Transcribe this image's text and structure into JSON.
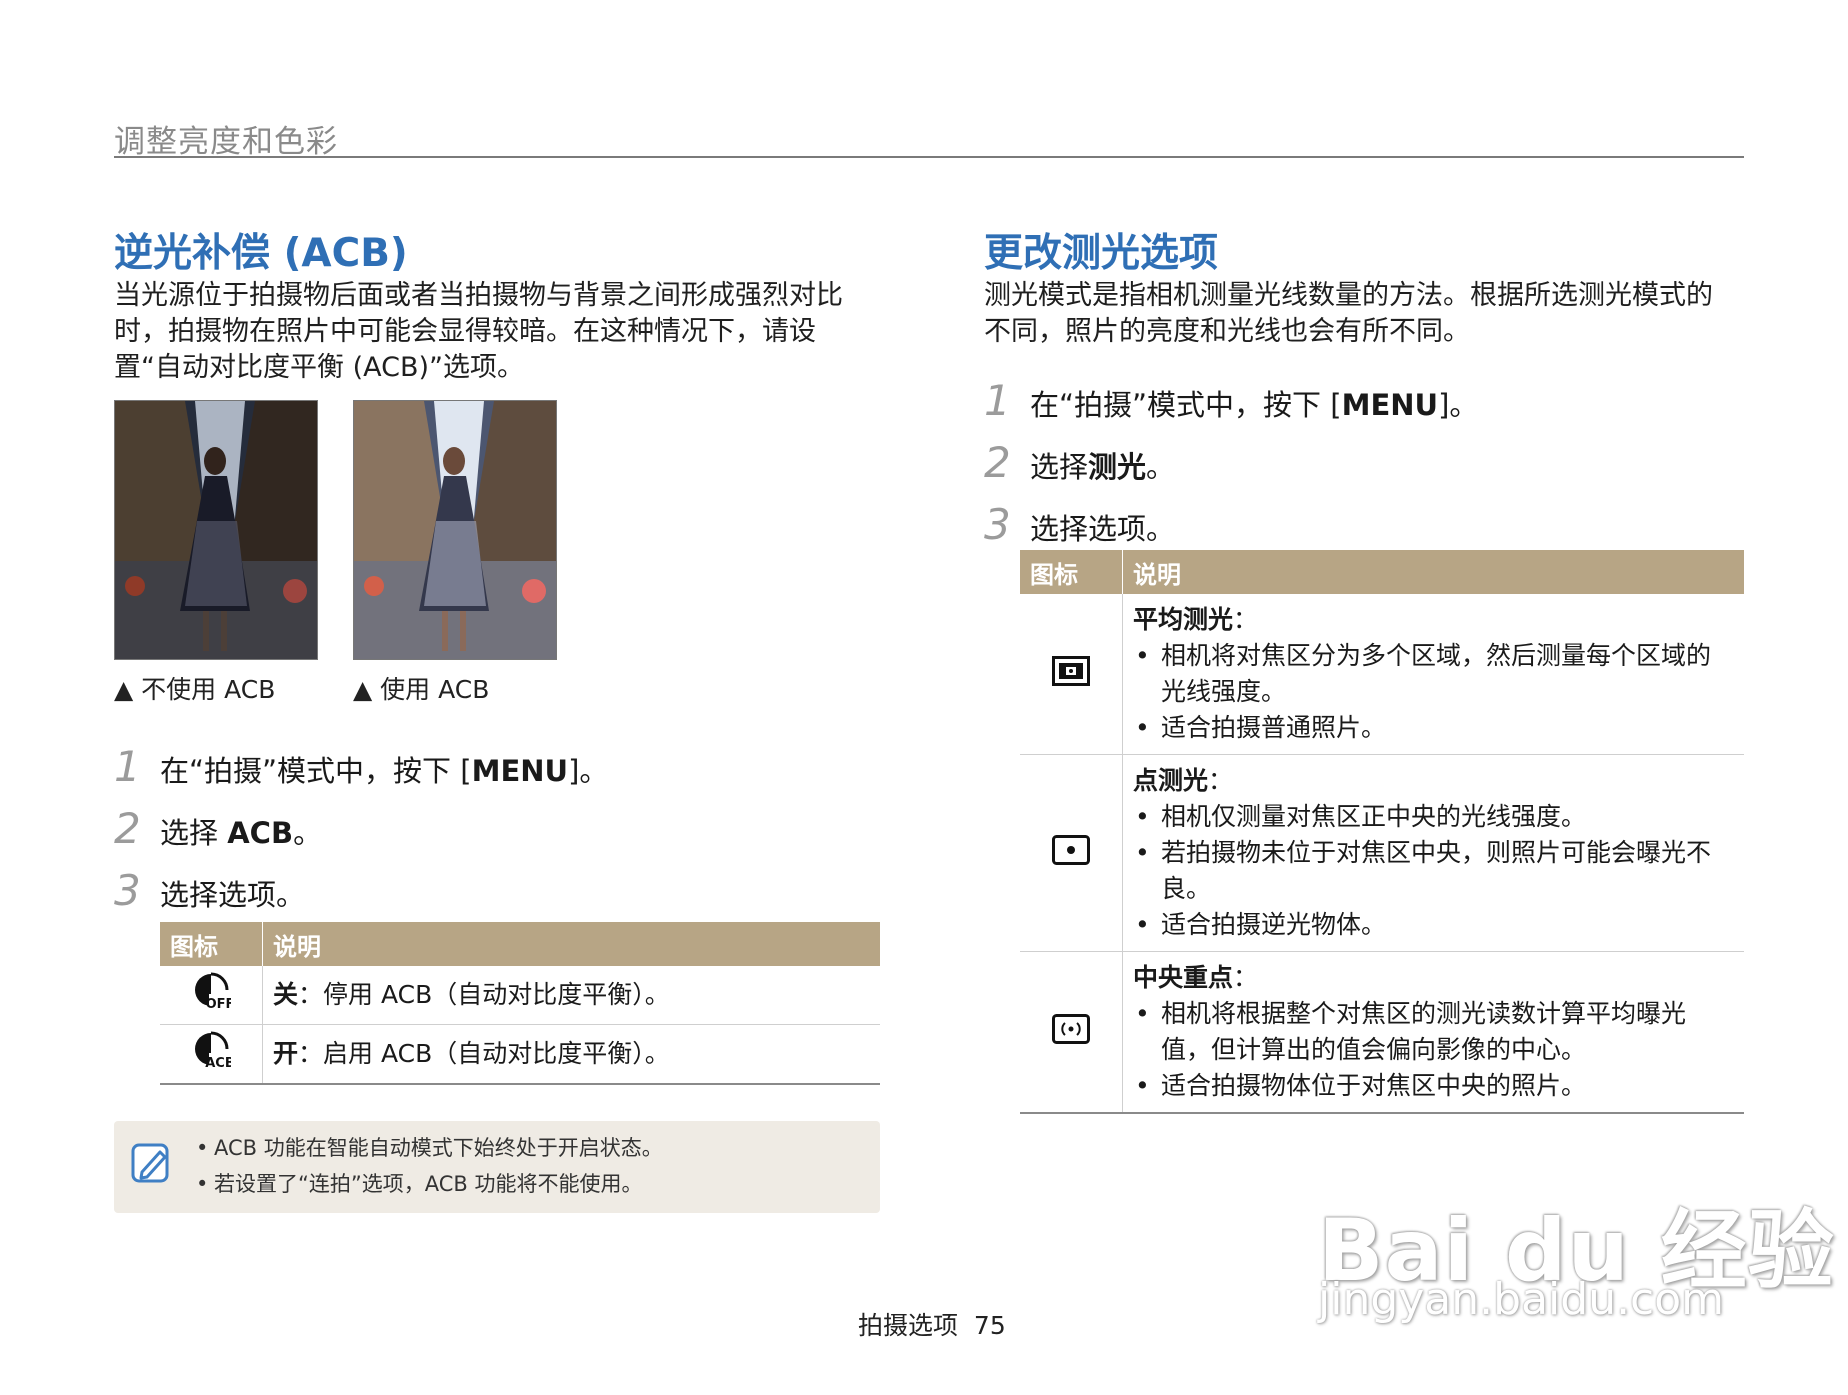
{
  "header": {
    "running_title": "调整亮度和色彩"
  },
  "left": {
    "title": "逆光补偿 (ACB)",
    "intro": [
      "当光源位于拍摄物后面或者当拍摄物与背景之间形成强烈对比",
      "时，拍摄物在照片中可能会显得较暗。在这种情况下，请设",
      "置“自动对比度平衡 (ACB)”选项。"
    ],
    "photos": [
      {
        "caption": "▲ 不使用 ACB"
      },
      {
        "caption": "▲ 使用 ACB"
      }
    ],
    "steps": [
      {
        "num": "1",
        "pre": "在“拍摄”模式中，按下 [",
        "bold": "MENU",
        "post": "]。"
      },
      {
        "num": "2",
        "pre": "选择 ",
        "bold": "ACB",
        "post": "。"
      },
      {
        "num": "3",
        "pre": "选择选项。",
        "bold": "",
        "post": ""
      }
    ],
    "table": {
      "headers": [
        "图标",
        "说明"
      ],
      "rows": [
        {
          "icon": "acb-off-icon",
          "label": "关",
          "text": "：停用 ACB（自动对比度平衡）。"
        },
        {
          "icon": "acb-on-icon",
          "label": "开",
          "text": "：启用 ACB（自动对比度平衡）。"
        }
      ]
    },
    "note": {
      "icon": "note-pencil-icon",
      "lines": [
        "ACB 功能在智能自动模式下始终处于开启状态。",
        "若设置了“连拍”选项，ACB 功能将不能使用。"
      ]
    }
  },
  "right": {
    "title": "更改测光选项",
    "intro": [
      "测光模式是指相机测量光线数量的方法。根据所选测光模式的",
      "不同，照片的亮度和光线也会有所不同。"
    ],
    "steps": [
      {
        "num": "1",
        "pre": "在“拍摄”模式中，按下 [",
        "bold": "MENU",
        "post": "]。"
      },
      {
        "num": "2",
        "pre": "选择",
        "bold": "测光",
        "post": "。"
      },
      {
        "num": "3",
        "pre": "选择选项。",
        "bold": "",
        "post": ""
      }
    ],
    "table": {
      "headers": [
        "图标",
        "说明"
      ],
      "rows": [
        {
          "icon": "multi-metering-icon",
          "title": "平均测光",
          "title_suffix": "：",
          "bullets": [
            "相机将对焦区分为多个区域，然后测量每个区域的光线强度。",
            "适合拍摄普通照片。"
          ]
        },
        {
          "icon": "spot-metering-icon",
          "title": "点测光",
          "title_suffix": "：",
          "bullets": [
            "相机仅测量对焦区正中央的光线强度。",
            "若拍摄物未位于对焦区中央，则照片可能会曝光不良。",
            "适合拍摄逆光物体。"
          ]
        },
        {
          "icon": "center-weighted-metering-icon",
          "title": "中央重点",
          "title_suffix": "：",
          "bullets": [
            "相机将根据整个对焦区的测光读数计算平均曝光值，但计算出的值会偏向影像的中心。",
            "适合拍摄物体位于对焦区中央的照片。"
          ]
        }
      ]
    }
  },
  "footer": {
    "section": "拍摄选项",
    "page": "75"
  },
  "watermark": {
    "brand": "Bai du 经验",
    "url": "jingyan.baidu.com"
  }
}
